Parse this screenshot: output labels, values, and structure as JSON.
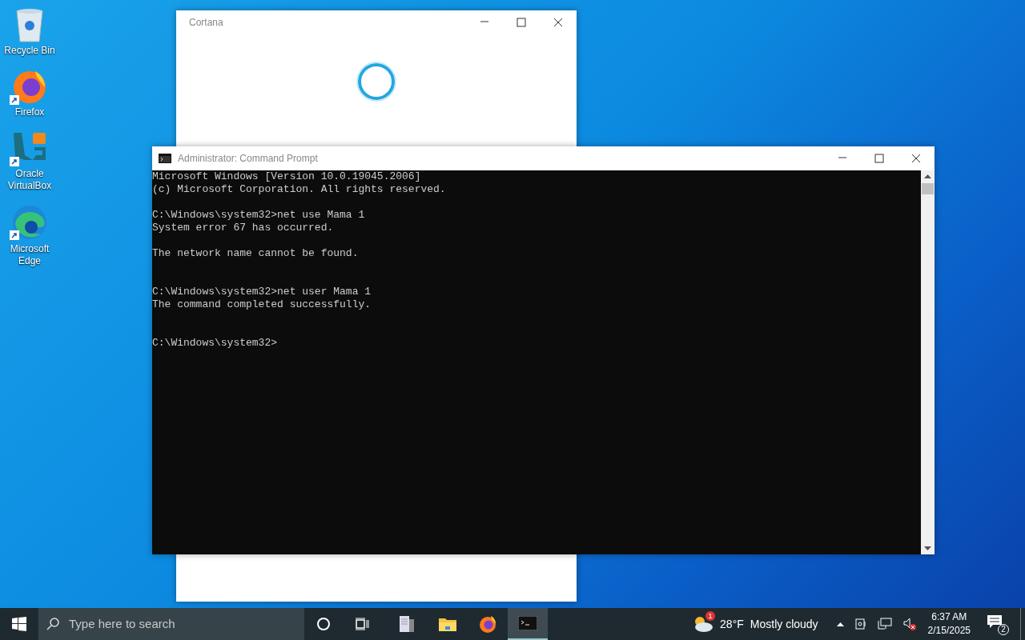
{
  "desktop_icons": [
    {
      "kind": "recycle",
      "label": "Recycle Bin",
      "shortcut": false
    },
    {
      "kind": "firefox",
      "label": "Firefox",
      "shortcut": true
    },
    {
      "kind": "virtualbox",
      "label": "Oracle VirtualBox",
      "shortcut": true
    },
    {
      "kind": "edge",
      "label": "Microsoft Edge",
      "shortcut": true
    }
  ],
  "cortana_window": {
    "title": "Cortana"
  },
  "cmd_window": {
    "title": "Administrator: Command Prompt",
    "header": [
      "Microsoft Windows [Version 10.0.19045.2006]",
      "(c) Microsoft Corporation. All rights reserved."
    ],
    "sessions": [
      {
        "paragraphs": [
          {
            "lines": [
              "C:\\Windows\\system32>net use Mama 1",
              "System error 67 has occurred."
            ]
          },
          {
            "lines": [
              "The network name cannot be found."
            ]
          }
        ]
      },
      {
        "paragraphs": [
          {
            "lines": [
              "C:\\Windows\\system32>net user Mama 1",
              "The command completed successfully."
            ]
          }
        ]
      },
      {
        "paragraphs": [
          {
            "lines": [
              "C:\\Windows\\system32>"
            ]
          }
        ]
      }
    ]
  },
  "taskbar": {
    "search": {
      "placeholder": "Type here to search"
    },
    "apps": [
      {
        "kind": "files",
        "selected": false
      },
      {
        "kind": "explorer",
        "selected": false
      },
      {
        "kind": "firefox",
        "selected": false
      },
      {
        "kind": "cmd",
        "selected": true
      }
    ],
    "weather": {
      "badge": "1",
      "temperature": "28°F",
      "condition": "Mostly cloudy"
    },
    "time": "6:37 AM",
    "date": "2/15/2025",
    "notifications": "2"
  }
}
